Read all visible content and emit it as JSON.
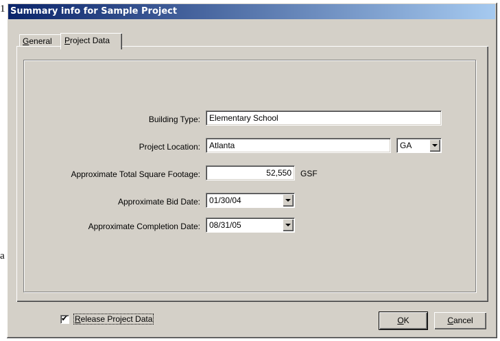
{
  "dialog": {
    "title": "Summary info for Sample Project",
    "tabs": [
      {
        "access_key": "G",
        "rest": "eneral",
        "active": false
      },
      {
        "access_key": "P",
        "rest": "roject Data",
        "active": true
      }
    ],
    "fields": {
      "building_type": {
        "label": "Building Type:",
        "value": "Elementary School"
      },
      "project_location": {
        "label": "Project Location:",
        "value": "Atlanta",
        "state": "GA"
      },
      "square_footage": {
        "label": "Approximate Total Square Footage:",
        "value": "52,550",
        "unit": "GSF"
      },
      "bid_date": {
        "label": "Approximate Bid Date:",
        "value": "01/30/04"
      },
      "completion_date": {
        "label": "Approximate Completion Date:",
        "value": "08/31/05"
      }
    },
    "release_checkbox": {
      "label": "Release Project Data",
      "access_key": "R",
      "rest": "elease Project Data",
      "checked": true,
      "check_glyph": "✔"
    },
    "buttons": {
      "ok": {
        "access_key": "O",
        "rest": "K"
      },
      "cancel": {
        "access_key": "C",
        "rest": "ancel"
      }
    }
  },
  "background_fragments": {
    "top_left": "1",
    "bottom_left": "a"
  }
}
